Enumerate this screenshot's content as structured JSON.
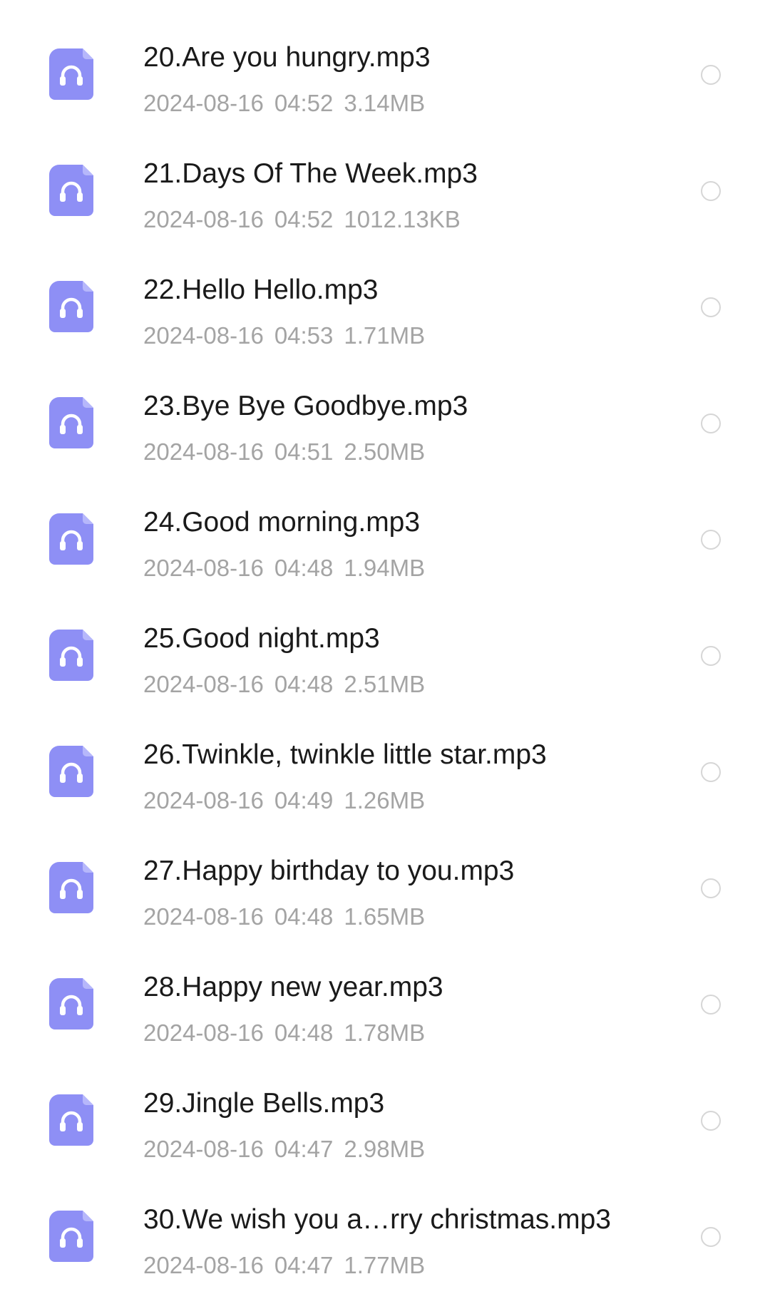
{
  "colors": {
    "icon_bg": "#8e8ff5",
    "icon_fold": "#b6b7fb",
    "title_text": "#1a1a1a",
    "meta_text": "#a4a4a4",
    "radio_border": "#d6d6d6"
  },
  "file_icon": "headphones-audio-file-icon",
  "files": [
    {
      "name": "20.Are you hungry.mp3",
      "date": "2024-08-16",
      "time": "04:52",
      "size": "3.14MB"
    },
    {
      "name": "21.Days Of The Week.mp3",
      "date": "2024-08-16",
      "time": "04:52",
      "size": "1012.13KB"
    },
    {
      "name": "22.Hello Hello.mp3",
      "date": "2024-08-16",
      "time": "04:53",
      "size": "1.71MB"
    },
    {
      "name": "23.Bye Bye Goodbye.mp3",
      "date": "2024-08-16",
      "time": "04:51",
      "size": "2.50MB"
    },
    {
      "name": "24.Good morning.mp3",
      "date": "2024-08-16",
      "time": "04:48",
      "size": "1.94MB"
    },
    {
      "name": "25.Good night.mp3",
      "date": "2024-08-16",
      "time": "04:48",
      "size": "2.51MB"
    },
    {
      "name": "26.Twinkle, twinkle little star.mp3",
      "date": "2024-08-16",
      "time": "04:49",
      "size": "1.26MB"
    },
    {
      "name": "27.Happy birthday to you.mp3",
      "date": "2024-08-16",
      "time": "04:48",
      "size": "1.65MB"
    },
    {
      "name": "28.Happy new year.mp3",
      "date": "2024-08-16",
      "time": "04:48",
      "size": "1.78MB"
    },
    {
      "name": "29.Jingle Bells.mp3",
      "date": "2024-08-16",
      "time": "04:47",
      "size": "2.98MB"
    },
    {
      "name": "30.We wish you a…rry christmas.mp3",
      "date": "2024-08-16",
      "time": "04:47",
      "size": "1.77MB"
    }
  ]
}
